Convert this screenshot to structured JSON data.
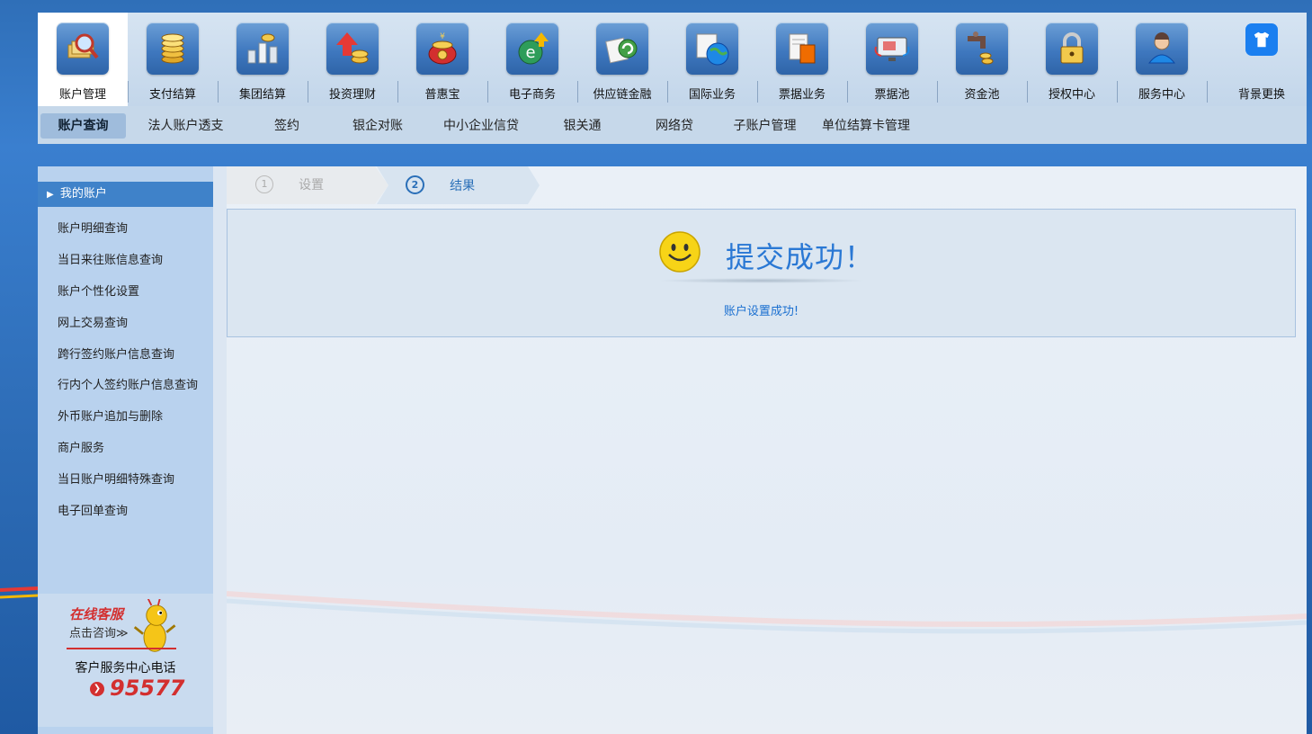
{
  "top_nav": {
    "items": [
      {
        "label": "账户管理",
        "icon": "magnifier-money-icon",
        "active": true
      },
      {
        "label": "支付结算",
        "icon": "coin-stack-icon"
      },
      {
        "label": "集团结算",
        "icon": "group-coins-icon"
      },
      {
        "label": "投资理财",
        "icon": "rising-arrow-coins-icon"
      },
      {
        "label": "普惠宝",
        "icon": "treasure-pot-icon"
      },
      {
        "label": "电子商务",
        "icon": "ecommerce-icon"
      },
      {
        "label": "供应链金融",
        "icon": "supply-chain-icon"
      },
      {
        "label": "国际业务",
        "icon": "globe-icon"
      },
      {
        "label": "票据业务",
        "icon": "bill-document-icon"
      },
      {
        "label": "票据池",
        "icon": "bill-pool-icon"
      },
      {
        "label": "资金池",
        "icon": "faucet-coins-icon"
      },
      {
        "label": "授权中心",
        "icon": "padlock-icon"
      },
      {
        "label": "服务中心",
        "icon": "user-service-icon"
      }
    ],
    "skin_label": "背景更换",
    "skin_icon": "tshirt-icon"
  },
  "sub_nav": {
    "items": [
      {
        "label": "账户查询",
        "active": true
      },
      {
        "label": "法人账户透支"
      },
      {
        "label": "签约"
      },
      {
        "label": "银企对账"
      },
      {
        "label": "中小企业信贷"
      },
      {
        "label": "银关通"
      },
      {
        "label": "网络贷"
      },
      {
        "label": "子账户管理"
      },
      {
        "label": "单位结算卡管理"
      }
    ]
  },
  "sidebar": {
    "header": "我的账户",
    "items": [
      "账户明细查询",
      "当日来往账信息查询",
      "账户个性化设置",
      "网上交易查询",
      "跨行签约账户信息查询",
      "行内个人签约账户信息查询",
      "外币账户追加与删除",
      "商户服务",
      "当日账户明细特殊查询",
      "电子回单查询"
    ],
    "support": {
      "online_service": "在线客服",
      "consult_link": "点击咨询≫",
      "hotline_label": "客户服务中心电话",
      "hotline_number": "95577"
    }
  },
  "steps": [
    {
      "number": "1",
      "label": "设置",
      "done": true
    },
    {
      "number": "2",
      "label": "结果",
      "current": true
    }
  ],
  "result": {
    "title": "提交成功！",
    "message": "账户设置成功!",
    "icon": "smiley-icon"
  },
  "colors": {
    "accent": "#2a78d4",
    "sidebar_header": "#3f82c9",
    "brand_red": "#e02020"
  }
}
